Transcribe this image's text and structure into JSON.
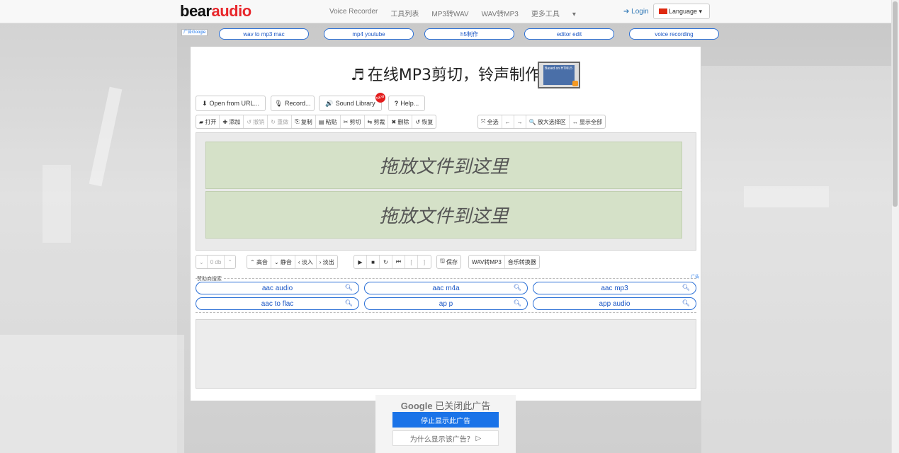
{
  "brand": {
    "logo_part1": "bear",
    "logo_part2": "audio"
  },
  "nav": {
    "items": [
      "Voice Recorder",
      "工具列表",
      "MP3转WAV",
      "WAV转MP3",
      "更多工具"
    ],
    "more_caret": "▾",
    "login": "Login",
    "language": "Language"
  },
  "ad_links": {
    "badge": "广告Google",
    "items": [
      "wav to mp3 mac",
      "mp4 youtube",
      "h5制作",
      "editor edit",
      "voice recording"
    ]
  },
  "title": {
    "text": "在线MP3剪切，铃声制作",
    "badge_text": "Based on HTML5"
  },
  "buttons": {
    "open_url": "Open from URL...",
    "record": "Record...",
    "sound_library": "Sound Library",
    "new_badge": "NEW",
    "help": "Help..."
  },
  "toolbar1": {
    "group1": [
      "打开",
      "添加",
      "撤销",
      "重做",
      "复制",
      "粘贴",
      "剪切",
      "剪裁",
      "删除",
      "恢复"
    ],
    "group2": [
      "全选",
      "←",
      "→",
      "放大选择区",
      "显示全部"
    ]
  },
  "drop_zone": {
    "text": "拖放文件到这里"
  },
  "toolbar2": {
    "volume": "0 db",
    "effects": [
      "高音",
      "静音",
      "淡入",
      "淡出"
    ],
    "save": "保存",
    "wav2mp3": "WAV转MP3",
    "converter": "音乐转换器"
  },
  "sponsor": {
    "label": "赞助商搜索",
    "ad_corner": "广告",
    "searches": [
      "aac audio",
      "aac m4a",
      "aac mp3",
      "aac to flac",
      "ap p",
      "app audio"
    ]
  },
  "google_ad": {
    "brand": "Google",
    "closed": "已关闭此广告",
    "stop": "停止显示此广告",
    "why": "为什么显示该广告？"
  },
  "colors": {
    "accent": "#e8262b",
    "link": "#1a56c5",
    "drop_zone": "#d5e1c8"
  }
}
